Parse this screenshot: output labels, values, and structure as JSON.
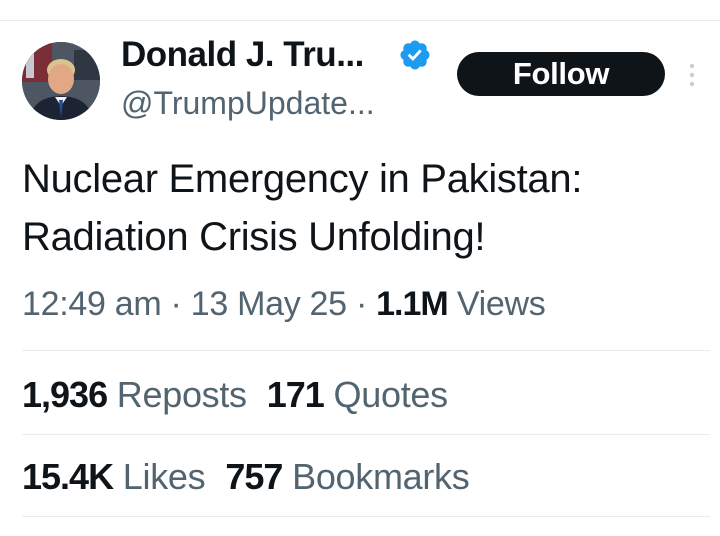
{
  "author": {
    "display_name": "Donald J. Tru...",
    "handle": "@TrumpUpdate...",
    "verified": true
  },
  "follow_label": "Follow",
  "tweet": {
    "line1": "Nuclear Emergency in Pakistan:",
    "line2": "Radiation Crisis Unfolding!"
  },
  "meta": {
    "time": "12:49 am",
    "separator": "·",
    "date": "13 May 25",
    "views_count": "1.1M",
    "views_label": "Views"
  },
  "stats": {
    "reposts_count": "1,936",
    "reposts_label": "Reposts",
    "quotes_count": "171",
    "quotes_label": "Quotes",
    "likes_count": "15.4K",
    "likes_label": "Likes",
    "bookmarks_count": "757",
    "bookmarks_label": "Bookmarks"
  },
  "icons": {
    "verified": "verified-badge-icon",
    "more": "more-options-icon"
  },
  "colors": {
    "verified_blue": "#1d9bf0",
    "text_primary": "#0f1419",
    "text_secondary": "#536471",
    "divider": "#e6ecf0"
  }
}
